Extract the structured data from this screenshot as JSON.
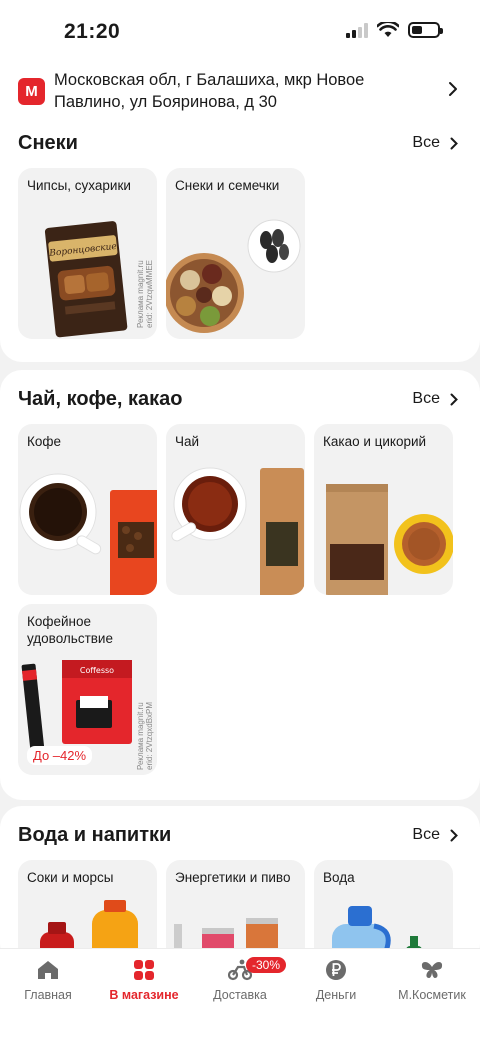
{
  "status": {
    "time": "21:20"
  },
  "address": {
    "logo_letter": "М",
    "text": "Московская обл, г Балашиха, мкр Новое Павлино, ул Бояринова, д 30"
  },
  "sections": [
    {
      "title": "Снеки",
      "see_all": "Все",
      "tiles": [
        {
          "label": "Чипсы, сухарики",
          "ad": "Реклама magnit.ru",
          "ad_id": "erid: 2VtzqwMMEE"
        },
        {
          "label": "Снеки и семечки"
        }
      ]
    },
    {
      "title": "Чай, кофе, какао",
      "see_all": "Все",
      "tiles": [
        {
          "label": "Кофе"
        },
        {
          "label": "Чай"
        },
        {
          "label": "Какао и цикорий"
        },
        {
          "label": "Кофейное удовольствие",
          "badge": "До –42%",
          "ad": "Реклама magnit.ru",
          "ad_id": "erid: 2VtzqxdBxPM"
        }
      ]
    },
    {
      "title": "Вода и напитки",
      "see_all": "Все",
      "tiles": [
        {
          "label": "Соки и морсы"
        },
        {
          "label": "Энергетики и пиво"
        },
        {
          "label": "Вода"
        }
      ]
    }
  ],
  "tabs": [
    {
      "label": "Главная",
      "icon": "home-icon",
      "active": false
    },
    {
      "label": "В магазине",
      "icon": "grid-icon",
      "active": true
    },
    {
      "label": "Доставка",
      "icon": "courier-icon",
      "active": false,
      "badge": "-30%"
    },
    {
      "label": "Деньги",
      "icon": "ruble-icon",
      "active": false
    },
    {
      "label": "М.Косметик",
      "icon": "butterfly-icon",
      "active": false
    }
  ],
  "colors": {
    "brand": "#e4262c",
    "background": "#f2f2f2",
    "card": "#ffffff"
  }
}
